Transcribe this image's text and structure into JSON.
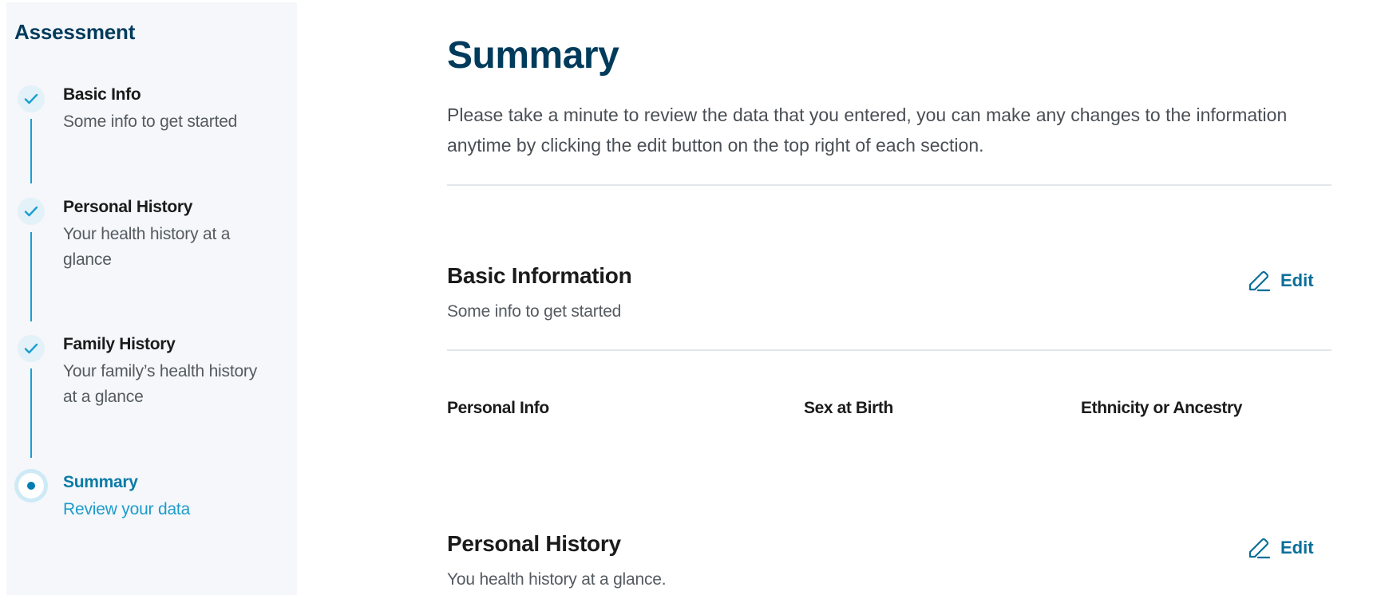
{
  "sidebar": {
    "title": "Assessment",
    "steps": [
      {
        "label": "Basic Info",
        "description": "Some info to get started",
        "status": "completed"
      },
      {
        "label": "Personal History",
        "description": "Your health history at a glance",
        "status": "completed"
      },
      {
        "label": "Family History",
        "description": "Your family’s health history at a glance",
        "status": "completed"
      },
      {
        "label": "Summary",
        "description": "Review your data",
        "status": "active"
      }
    ]
  },
  "main": {
    "title": "Summary",
    "intro": "Please take a minute to review the data that you entered, you can make any changes to the information anytime by clicking the edit button on the top right of each section.",
    "sections": [
      {
        "title": "Basic Information",
        "subtitle": "Some info to get started",
        "edit_label": "Edit",
        "fields": [
          "Personal Info",
          "Sex at Birth",
          "Ethnicity or Ancestry"
        ]
      },
      {
        "title": "Personal History",
        "subtitle": "You health history at a glance.",
        "edit_label": "Edit"
      }
    ]
  },
  "colors": {
    "primary_dark": "#003b5c",
    "accent": "#1a9fd0",
    "link": "#0a6f99",
    "sidebar_bg": "#f5f7fa"
  },
  "icons": {
    "completed_step": "check-icon",
    "active_step": "dot-icon",
    "edit": "pencil-icon"
  }
}
